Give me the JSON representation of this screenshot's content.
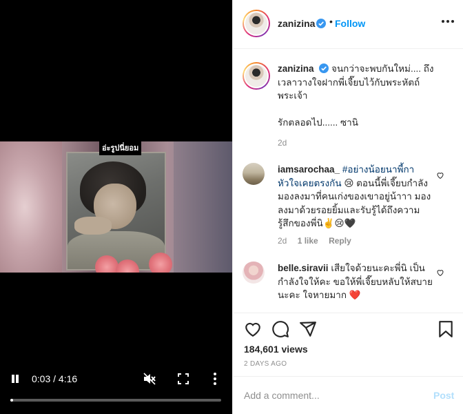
{
  "video": {
    "caption": "อ่ะรูปนี่ยอม",
    "time_display": "0:03 / 4:16",
    "progress_fraction": 0.012,
    "controls": {
      "pause_icon": "pause-icon",
      "mute_icon": "muted-speaker-icon",
      "fullscreen_icon": "fullscreen-icon",
      "more_icon": "more-vertical-icon"
    }
  },
  "header": {
    "username": "zanizina",
    "separator": "•",
    "follow_label": "Follow",
    "verified_icon": "verified-badge-icon",
    "more_icon": "more-horizontal-icon"
  },
  "post": {
    "username": "zanizina",
    "caption_line1": "จนกว่าจะพบกันใหม่.... ถึงเวลาวางใจฝากพี่เจี๊ยบไว้กับพระหัตถ์พระเจ้า",
    "caption_line2": "รักตลอดไป...... ซานิ",
    "time": "2d"
  },
  "comments": [
    {
      "username": "iamsarochaa_",
      "hashtag": "#อย่างน้อยนาพี้กาหัวใจเคยตรงกัน",
      "text": "😢 ตอนนี้พี่เจี๊ยบกำลังมองลงมาที่คนเก่งของเขาอยู่น้าาา มองลงมาด้วยรอยยิ้มและรับรู้ได้ถึงความรู้สึกของพี่นิ✌️😢🖤",
      "time": "2d",
      "likes": "1 like",
      "reply_label": "Reply"
    },
    {
      "username": "belle.siravii",
      "text": "เสียใจด้วยนะคะพี่นิ เป็นกำลังใจให้คะ ขอให้พี่เจี๊ยบหลับให้สบายนะคะ ใจหายมาก ❤️"
    }
  ],
  "actions": {
    "like_icon": "heart-icon",
    "comment_icon": "comment-icon",
    "share_icon": "share-icon",
    "save_icon": "bookmark-icon",
    "views": "184,601 views",
    "posted_ago": "2 DAYS AGO"
  },
  "add_comment": {
    "placeholder": "Add a comment...",
    "post_label": "Post"
  },
  "colors": {
    "accent": "#0095f6",
    "post_disabled": "#b2dffc",
    "hashtag": "#00376b",
    "heart_emoji": "#ed4956",
    "muted_text": "#8e8e8e"
  }
}
